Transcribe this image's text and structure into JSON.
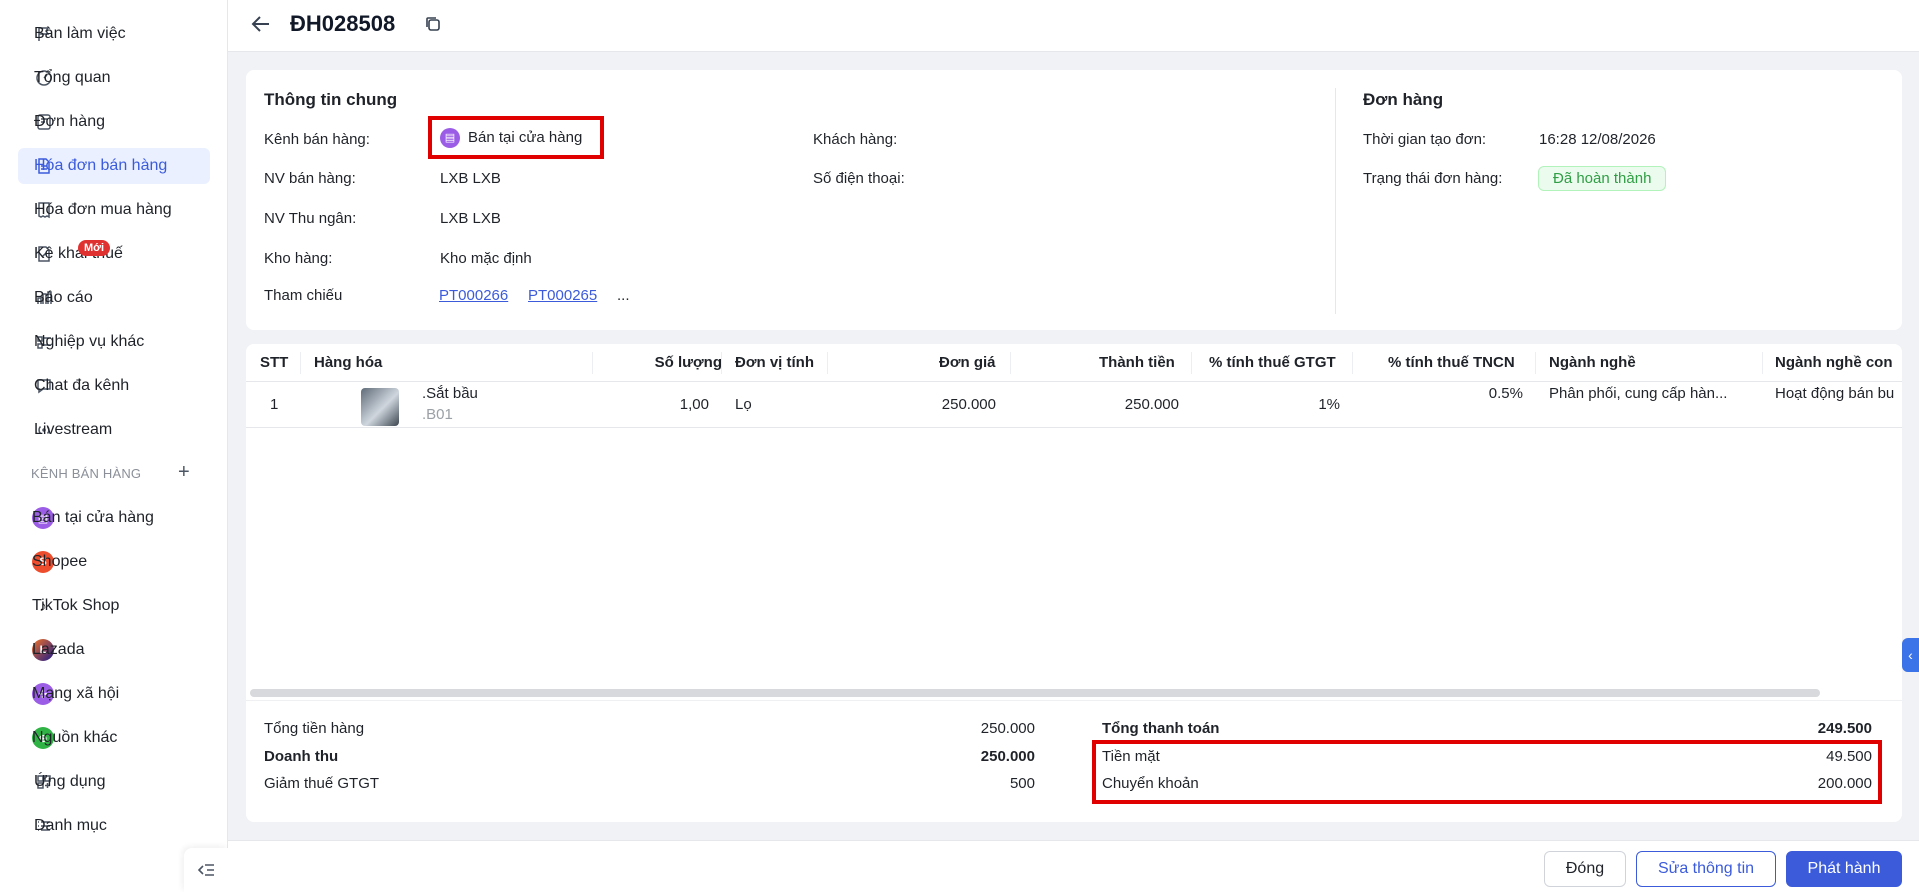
{
  "sidebar": {
    "items": [
      {
        "label": "Bàn làm việc",
        "icon": "flag-icon"
      },
      {
        "label": "Tổng quan",
        "icon": "gauge-icon"
      },
      {
        "label": "Đơn hàng",
        "icon": "order-icon"
      },
      {
        "label": "Hóa đơn bán hàng",
        "icon": "invoice-icon",
        "active": true
      },
      {
        "label": "Hóa đơn mua hàng",
        "icon": "receipt-icon"
      },
      {
        "label": "Kê khai thuế",
        "icon": "tax-icon",
        "badge": "Mới"
      },
      {
        "label": "Báo cáo",
        "icon": "bar-chart-icon"
      },
      {
        "label": "Nghiệp vụ khác",
        "icon": "list-icon"
      },
      {
        "label": "Chat đa kênh",
        "icon": "chat-icon"
      },
      {
        "label": "Livestream",
        "icon": "broadcast-icon"
      }
    ],
    "channels_title": "KÊNH BÁN HÀNG",
    "channels": [
      {
        "label": "Bán tại cửa hàng",
        "color": "#9b5de5"
      },
      {
        "label": "Shopee",
        "color": "#ee4d2d"
      },
      {
        "label": "TikTok Shop",
        "color": "#111111"
      },
      {
        "label": "Lazada",
        "color": "#1a1a8c"
      },
      {
        "label": "Mạng xã hội",
        "color": "#9b5de5"
      },
      {
        "label": "Nguồn khác",
        "color": "#2fb344"
      }
    ],
    "bottom": [
      {
        "label": "Ứng dụng",
        "icon": "apps-icon"
      },
      {
        "label": "Danh mục",
        "icon": "menu-list-icon"
      }
    ]
  },
  "header": {
    "order_code": "ĐH028508"
  },
  "general": {
    "title": "Thông tin chung",
    "channel_label": "Kênh bán hàng:",
    "channel_value": "Bán tại cửa hàng",
    "seller_label": "NV bán hàng:",
    "seller_value": "LXB LXB",
    "cashier_label": "NV Thu ngân:",
    "cashier_value": "LXB LXB",
    "warehouse_label": "Kho hàng:",
    "warehouse_value": "Kho mặc định",
    "ref_label": "Tham chiếu",
    "ref_1": "PT000266",
    "ref_2": "PT000265",
    "ref_more": "...",
    "customer_label": "Khách hàng:",
    "phone_label": "Số điện thoại:"
  },
  "order": {
    "title": "Đơn hàng",
    "created_label": "Thời gian tạo đơn:",
    "created_value": "16:28 12/08/2026",
    "status_label": "Trạng thái đơn hàng:",
    "status_value": "Đã hoàn thành",
    "status_color": "#2f9e44"
  },
  "table": {
    "headers": {
      "stt": "STT",
      "product": "Hàng hóa",
      "qty": "Số lượng",
      "unit": "Đơn vị tính",
      "price": "Đơn giá",
      "amount": "Thành tiền",
      "vat": "% tính thuế GTGT",
      "pit": "% tính thuế TNCN",
      "industry": "Ngành nghề",
      "sub_industry": "Ngành nghề con"
    },
    "rows": [
      {
        "stt": "1",
        "name": ".Sắt bầu",
        "sku": ".B01",
        "qty": "1,00",
        "unit": "Lọ",
        "price": "250.000",
        "amount": "250.000",
        "vat": "1%",
        "pit": "0.5%",
        "industry": "Phân phối, cung cấp hàn...",
        "sub_industry": "Hoạt động bán bu"
      }
    ]
  },
  "summary": {
    "goods_total_label": "Tổng tiền hàng",
    "goods_total_value": "250.000",
    "revenue_label": "Doanh thu",
    "revenue_value": "250.000",
    "vat_discount_label": "Giảm thuế GTGT",
    "vat_discount_value": "500",
    "grand_total_label": "Tổng thanh toán",
    "grand_total_value": "249.500",
    "cash_label": "Tiền mặt",
    "cash_value": "49.500",
    "transfer_label": "Chuyển khoản",
    "transfer_value": "200.000"
  },
  "footer": {
    "close_label": "Đóng",
    "edit_label": "Sửa thông tin",
    "issue_label": "Phát hành"
  },
  "colors": {
    "accent": "#3b5bdb",
    "highlight_border": "#e00000"
  }
}
